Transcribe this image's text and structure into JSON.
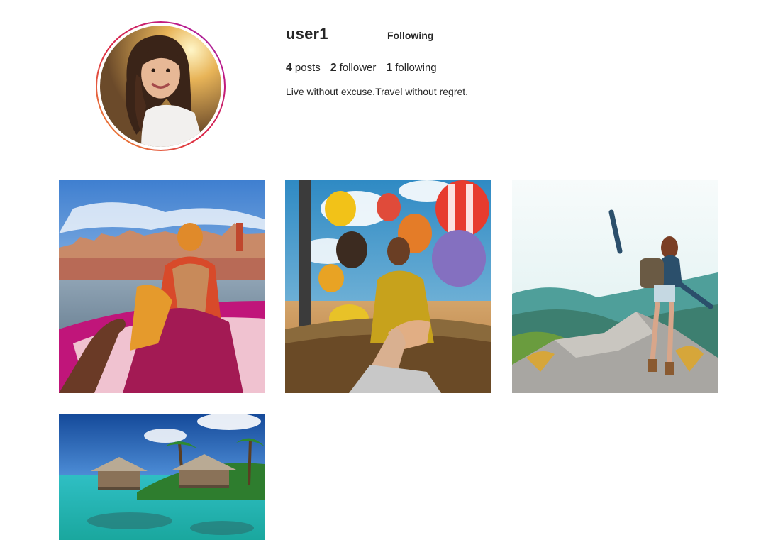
{
  "profile": {
    "username": "user1",
    "follow_button": "Following",
    "stats": {
      "posts_count": "4",
      "posts_label": "posts",
      "follower_count": "2",
      "follower_label": "follower",
      "following_count": "1",
      "following_label": "following"
    },
    "bio": "Live without excuse.Travel without regret."
  },
  "posts": [
    {
      "subject": "varanasi-boat-follow-me"
    },
    {
      "subject": "hot-air-balloons-follow-me"
    },
    {
      "subject": "hiker-on-mountain"
    },
    {
      "subject": "tropical-bungalows"
    }
  ],
  "colors": {
    "text": "#262626",
    "avatar_ring_start": "#f09433",
    "avatar_ring_end": "#8a3ab9"
  }
}
